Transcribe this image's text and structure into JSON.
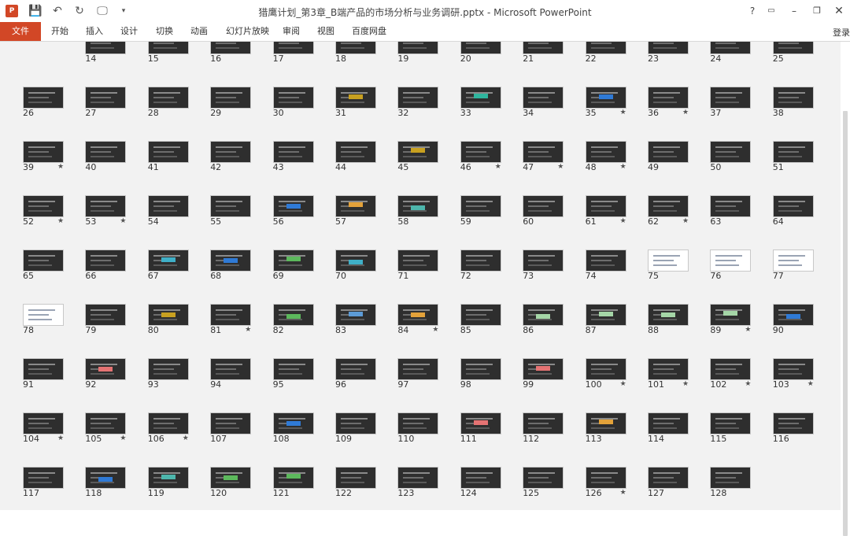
{
  "window": {
    "title": "猎鹰计划_第3章_B端产品的市场分析与业务调研.pptx - Microsoft PowerPoint",
    "app_icon": "P",
    "controls": {
      "help": "?",
      "minimize": "–",
      "maximize": "❐",
      "close": "✕",
      "ribbon_options": "▭"
    }
  },
  "quick_access": {
    "save": "💾",
    "undo": "↶",
    "redo": "↻",
    "present": "🖵",
    "customize": "▾"
  },
  "ribbon": {
    "tabs": [
      "文件",
      "开始",
      "插入",
      "设计",
      "切换",
      "动画",
      "幻灯片放映",
      "审阅",
      "视图",
      "百度网盘"
    ],
    "signin": "登录"
  },
  "slide_sorter": {
    "first_slide": 14,
    "last_slide": 128,
    "per_row": 13,
    "starred": [
      35,
      36,
      39,
      46,
      47,
      48,
      52,
      53,
      61,
      62,
      81,
      84,
      89,
      100,
      101,
      102,
      103,
      104,
      105,
      106,
      126
    ],
    "light_slides": [
      75,
      76,
      77,
      78
    ],
    "accent_slides": {
      "31": "#c8a020",
      "33": "#2fb59e",
      "35": "#2f7ad6",
      "45": "#c8a020",
      "56": "#2f7ad6",
      "57": "#e3a23a",
      "58": "#4db6ac",
      "67": "#3fb0c8",
      "68": "#2f7ad6",
      "69": "#5cb85c",
      "70": "#3fb0c8",
      "80": "#c8a020",
      "82": "#5cb85c",
      "83": "#5c9bd6",
      "84": "#e3a23a",
      "86": "#a5d6a7",
      "87": "#a5d6a7",
      "88": "#a5d6a7",
      "89": "#a5d6a7",
      "90": "#2f7ad6",
      "92": "#e57373",
      "99": "#e57373",
      "108": "#2f7ad6",
      "111": "#e57373",
      "113": "#e3a23a",
      "118": "#2f7ad6",
      "119": "#4db6ac",
      "120": "#5cb85c",
      "121": "#5cb85c"
    }
  }
}
